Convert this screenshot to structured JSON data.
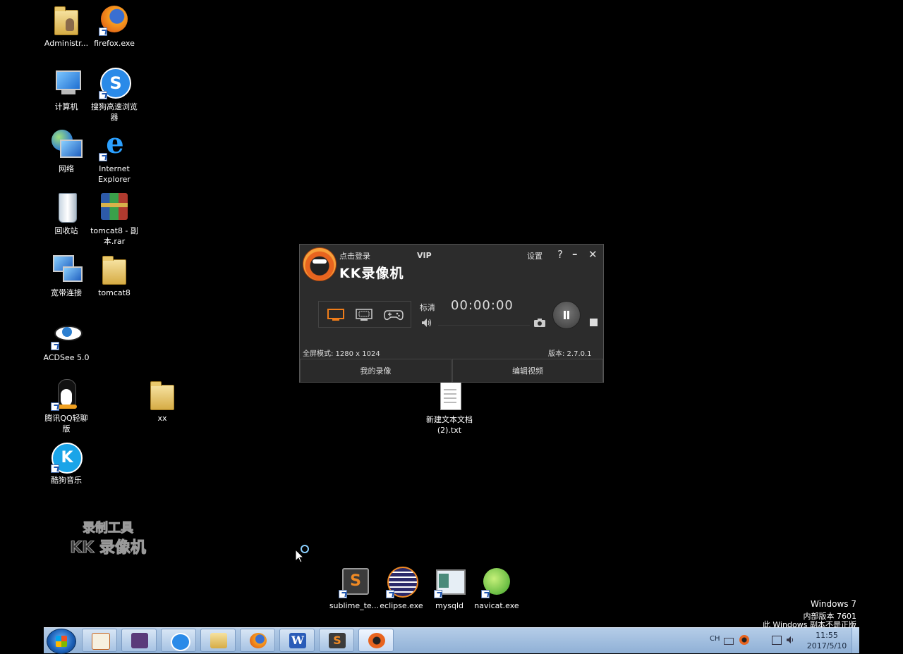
{
  "desktop": {
    "icons": [
      {
        "label": "Administr..."
      },
      {
        "label": "firefox.exe"
      },
      {
        "label": "计算机"
      },
      {
        "label": "搜狗高速浏览器"
      },
      {
        "label": "网络"
      },
      {
        "label": "Internet Explorer"
      },
      {
        "label": "回收站"
      },
      {
        "label": "tomcat8 - 副本.rar"
      },
      {
        "label": "宽带连接"
      },
      {
        "label": "tomcat8"
      },
      {
        "label": "ACDSee 5.0"
      },
      {
        "label": "腾讯QQ轻聊版"
      },
      {
        "label": "xx"
      },
      {
        "label": "酷狗音乐"
      },
      {
        "label": "新建文本文档 (2).txt"
      },
      {
        "label": "sublime_te..."
      },
      {
        "label": "eclipse.exe"
      },
      {
        "label": "mysqld"
      },
      {
        "label": "navicat.exe"
      }
    ],
    "watermark": {
      "line1": "录制工具",
      "line2": "KK 录像机"
    },
    "windows_info": {
      "line1": "Windows 7",
      "line2": "内部版本 7601",
      "line3": "此 Windows 副本不是正版"
    }
  },
  "kk_window": {
    "login_text": "点击登录",
    "vip": "VIP",
    "settings": "设置",
    "help": "?",
    "minimize": "–",
    "close": "✕",
    "title": "KK录像机",
    "quality": "标清",
    "timer": "00:00:00",
    "fullscreen_mode": "全屏模式: 1280 x 1024",
    "version": "版本: 2.7.0.1",
    "my_recordings": "我的录像",
    "edit_video": "编辑视频",
    "accent_color": "#f07d1a"
  },
  "taskbar": {
    "tray_lang": "CH",
    "clock_time": "11:55",
    "clock_date": "2017/5/10"
  }
}
